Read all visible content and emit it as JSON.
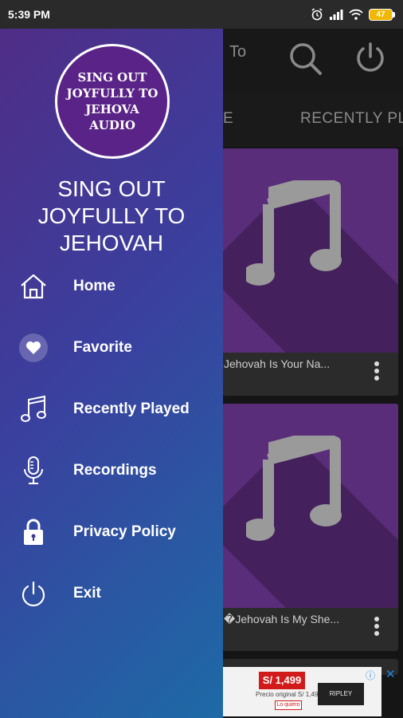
{
  "status_bar": {
    "time": "5:39 PM",
    "battery": "47"
  },
  "app_bar": {
    "title_fragment": "To"
  },
  "tabs": [
    "E",
    "RECENTLY PL"
  ],
  "songs": [
    {
      "title": "Jehovah Is Your Na..."
    },
    {
      "title": "�Jehovah Is My She..."
    }
  ],
  "ad": {
    "price": "S/ 1,499",
    "note": "Precio original S/ 1,499",
    "cta": "Lo quiero",
    "logo": "RIPLEY",
    "info": "ⓘ",
    "close": "✕"
  },
  "drawer": {
    "logo_text": "SING OUT JOYFULLY TO JEHOVA AUDIO",
    "title": "SING OUT JOYFULLY TO JEHOVAH",
    "items": [
      {
        "label": "Home",
        "icon": "home-icon"
      },
      {
        "label": "Favorite",
        "icon": "heart-icon"
      },
      {
        "label": "Recently Played",
        "icon": "music-note-icon"
      },
      {
        "label": "Recordings",
        "icon": "microphone-icon"
      },
      {
        "label": "Privacy Policy",
        "icon": "lock-icon"
      },
      {
        "label": "Exit",
        "icon": "power-icon"
      }
    ]
  },
  "colors": {
    "drawer_gradient_start": "#4f2d86",
    "drawer_gradient_end": "#1d6aa6",
    "album_art": "#5a2d7a",
    "note_gray": "#9a9a9a",
    "battery": "#f0b800"
  }
}
